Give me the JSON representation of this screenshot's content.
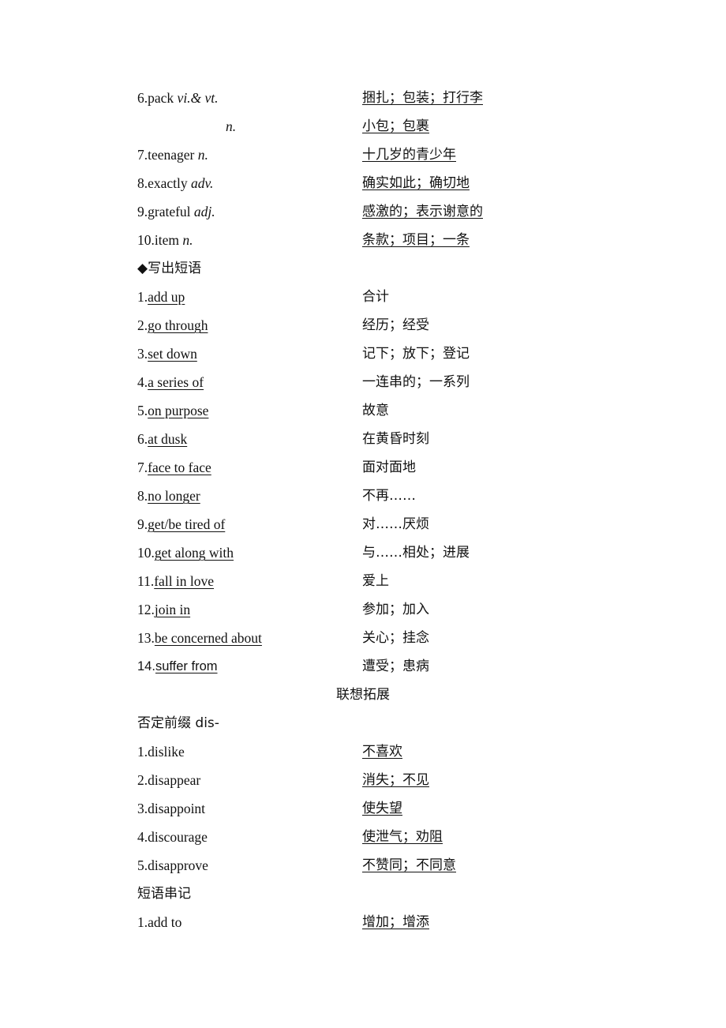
{
  "vocab": [
    {
      "num": "6.",
      "word": "pack",
      "pos": "vi.& vt.",
      "meaning": "捆扎；包装；打行李"
    },
    {
      "num": "",
      "word": "",
      "pos": "n.",
      "meaning": "小包；包裹"
    },
    {
      "num": "7.",
      "word": "teenager",
      "pos": "n.",
      "meaning": "十几岁的青少年"
    },
    {
      "num": "8.",
      "word": "exactly",
      "pos": "adv.",
      "meaning": "确实如此；确切地"
    },
    {
      "num": "9.",
      "word": "grateful",
      "pos": "adj.",
      "meaning": "感激的；表示谢意的"
    },
    {
      "num": "10.",
      "word": "item",
      "pos": "n.",
      "meaning": "条款；项目；一条"
    }
  ],
  "phrases_heading": "◆写出短语",
  "phrases": [
    {
      "num": "1.",
      "phrase": "add up",
      "meaning": "合计"
    },
    {
      "num": "2.",
      "phrase": "go through",
      "meaning": "经历；经受"
    },
    {
      "num": "3.",
      "phrase": "set down",
      "meaning": "记下；放下；登记"
    },
    {
      "num": "4.",
      "phrase": "a series of",
      "meaning": "一连串的；一系列"
    },
    {
      "num": "5.",
      "phrase": "on purpose",
      "meaning": "故意"
    },
    {
      "num": "6.",
      "phrase": "at dusk",
      "meaning": "在黄昏时刻"
    },
    {
      "num": "7.",
      "phrase": "face to face",
      "meaning": "面对面地"
    },
    {
      "num": "8.",
      "phrase": "no longer",
      "meaning": "不再……"
    },
    {
      "num": "9.",
      "phrase": "get/be tired of",
      "meaning": "对……厌烦"
    },
    {
      "num": "10.",
      "phrase": "get along with",
      "meaning": "与……相处；进展"
    },
    {
      "num": "11.",
      "phrase": "fall in love",
      "meaning": "爱上"
    },
    {
      "num": "12.",
      "phrase": "join in",
      "meaning": "参加；加入"
    },
    {
      "num": "13.",
      "phrase": "be concerned about",
      "meaning": "关心；挂念"
    },
    {
      "num": "14.",
      "phrase": "suffer from",
      "meaning": "遭受；患病"
    }
  ],
  "expansion_heading": "联想拓展",
  "prefix_heading": "否定前缀 dis-",
  "prefix_words": [
    {
      "num": "1.",
      "word": "dislike",
      "meaning": "不喜欢"
    },
    {
      "num": "2.",
      "word": "disappear",
      "meaning": "消失；不见"
    },
    {
      "num": "3.",
      "word": "disappoint",
      "meaning": "使失望"
    },
    {
      "num": "4.",
      "word": "discourage",
      "meaning": "使泄气；劝阻"
    },
    {
      "num": "5.",
      "word": "disapprove",
      "meaning": "不赞同；不同意"
    }
  ],
  "chain_heading": "短语串记",
  "chain": [
    {
      "num": "1.",
      "phrase": "add to",
      "meaning": "增加；增添"
    }
  ]
}
